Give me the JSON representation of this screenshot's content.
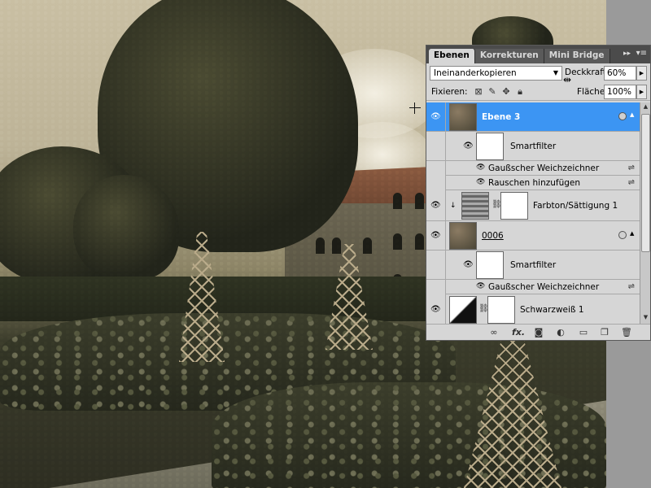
{
  "panel": {
    "tabs": [
      {
        "label": "Ebenen",
        "active": true
      },
      {
        "label": "Korrekturen",
        "active": false
      },
      {
        "label": "Mini Bridge",
        "active": false
      }
    ],
    "collapse_icon": "double-chevron-right-icon",
    "menu_icon": "panel-menu-icon",
    "blend_mode": "Ineinanderkopieren",
    "opacity_label": "Deckkraft:",
    "opacity_value": "60%",
    "lock_label": "Fixieren:",
    "fill_label": "Fläche:",
    "fill_value": "100%",
    "lock_icons": [
      "lock-transparency-icon",
      "lock-brush-icon",
      "lock-move-icon",
      "lock-all-icon"
    ]
  },
  "layers": [
    {
      "name": "Ebene 3",
      "type": "smart-object",
      "selected": true,
      "visible": true
    },
    {
      "name": "Smartfilter",
      "type": "smartfilter-header"
    },
    {
      "name": "Gaußscher Weichzeichner",
      "type": "filter"
    },
    {
      "name": "Rauschen hinzufügen",
      "type": "filter"
    },
    {
      "name": "Farbton/Sättigung 1",
      "type": "adjustment",
      "visible": true
    },
    {
      "name": "0006",
      "type": "smart-object",
      "visible": true
    },
    {
      "name": "Smartfilter",
      "type": "smartfilter-header"
    },
    {
      "name": "Gaußscher Weichzeichner",
      "type": "filter"
    },
    {
      "name": "Schwarzweiß 1",
      "type": "adjustment",
      "visible": true
    }
  ],
  "bottom_icons": [
    "link-layers-icon",
    "fx-icon",
    "add-mask-icon",
    "new-adjustment-icon",
    "new-group-icon",
    "new-layer-icon",
    "trash-icon"
  ],
  "bottom_labels": {
    "fx": "fx."
  }
}
